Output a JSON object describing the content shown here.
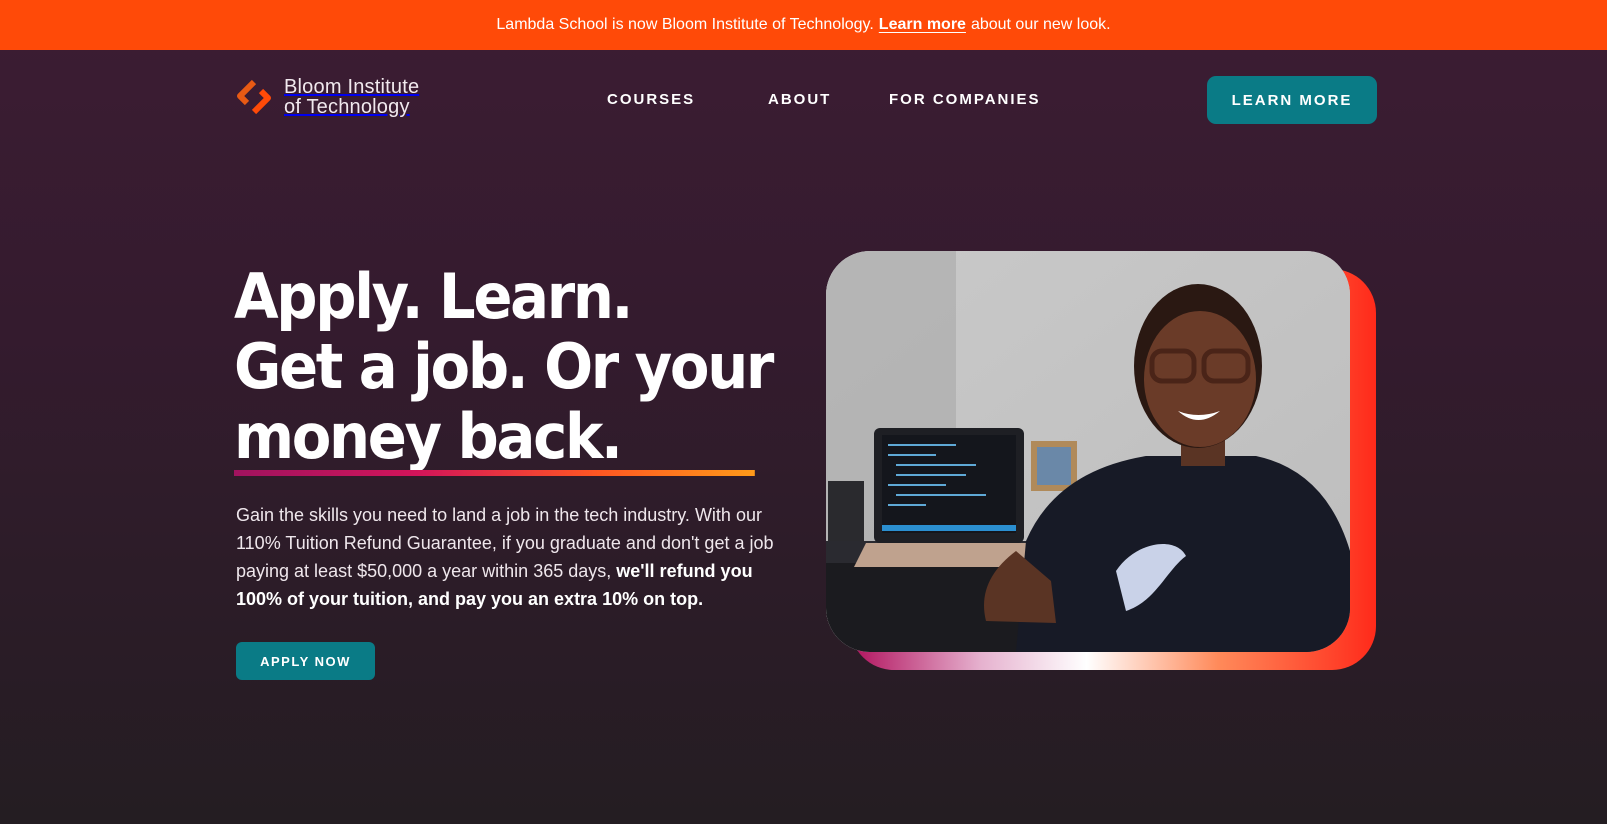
{
  "banner": {
    "text_before": "Lambda School is now Bloom Institute of Technology.",
    "link": "Learn more",
    "text_after": "about our new look."
  },
  "logo": {
    "line1": "Bloom Institute",
    "line2": "of Technology"
  },
  "nav": {
    "courses": "COURSES",
    "about": "ABOUT",
    "companies": "FOR COMPANIES",
    "cta": "LEARN MORE"
  },
  "hero": {
    "line1": "Apply. Learn.",
    "line2": "Get a job. Or your",
    "line3": "money back.",
    "desc_plain": "Gain the skills you need to land a job in the tech industry. With our 110% Tuition Refund Guarantee, if you graduate and don't get a job paying at least $50,000 a year within 365 days,",
    "desc_bold": "we'll refund you 100% of your tuition, and pay you an extra 10% on top.",
    "apply": "APPLY NOW"
  },
  "colors": {
    "banner": "#ff4a08",
    "accent": "#0a7b86",
    "background": "#3c1c33"
  }
}
